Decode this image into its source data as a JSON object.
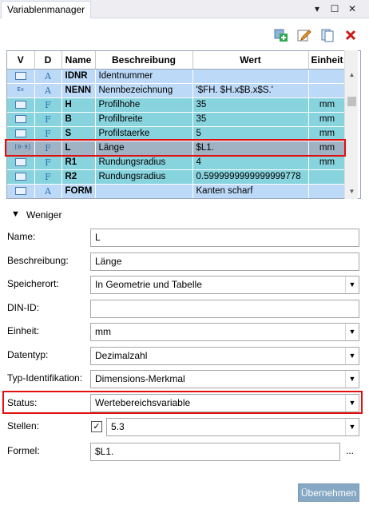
{
  "window": {
    "tab_label": "Variablenmanager"
  },
  "grid": {
    "columns": [
      "V",
      "D",
      "Name",
      "Beschreibung",
      "Wert",
      "Einheit"
    ],
    "rows": [
      {
        "v": "",
        "d": "A",
        "name": "IDNR",
        "desc": "Identnummer",
        "value": "",
        "unit": ""
      },
      {
        "v": "Ex",
        "d": "A",
        "name": "NENN",
        "desc": "Nennbezeichnung",
        "value": "'$FH. $H.x$B.x$S.'",
        "unit": ""
      },
      {
        "v": "",
        "d": "F",
        "name": "H",
        "desc": "Profilhohe",
        "value": "35",
        "unit": "mm"
      },
      {
        "v": "",
        "d": "F",
        "name": "B",
        "desc": "Profilbreite",
        "value": "35",
        "unit": "mm"
      },
      {
        "v": "",
        "d": "F",
        "name": "S",
        "desc": "Profilstaerke",
        "value": "5",
        "unit": "mm"
      },
      {
        "v": "[0-9]",
        "d": "F",
        "name": "L",
        "desc": "Länge",
        "value": "$L1.",
        "unit": "mm"
      },
      {
        "v": "",
        "d": "F",
        "name": "R1",
        "desc": "Rundungsradius",
        "value": "4",
        "unit": "mm"
      },
      {
        "v": "",
        "d": "F",
        "name": "R2",
        "desc": "Rundungsradius",
        "value": "0.5999999999999999778",
        "unit": ""
      },
      {
        "v": "",
        "d": "A",
        "name": "FORM",
        "desc": "",
        "value": "Kanten scharf",
        "unit": ""
      }
    ]
  },
  "toggle": {
    "label": "Weniger"
  },
  "form": {
    "name_label": "Name:",
    "name_value": "L",
    "desc_label": "Beschreibung:",
    "desc_value": "Länge",
    "storage_label": "Speicherort:",
    "storage_value": "In Geometrie und Tabelle",
    "din_label": "DIN-ID:",
    "din_value": "",
    "unit_label": "Einheit:",
    "unit_value": "mm",
    "type_label": "Datentyp:",
    "type_value": "Dezimalzahl",
    "typeid_label": "Typ-Identifikation:",
    "typeid_value": "Dimensions-Merkmal",
    "status_label": "Status:",
    "status_value": "Wertebereichsvariable",
    "digits_label": "Stellen:",
    "digits_value": "5.3",
    "formula_label": "Formel:",
    "formula_value": "$L1.",
    "formula_more": "..."
  },
  "apply_button": "Übernehmen"
}
